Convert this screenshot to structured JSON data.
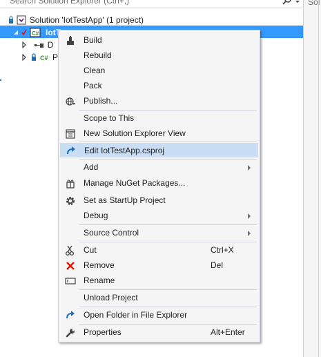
{
  "search": {
    "text": "Search Solution Explorer (Ctrl+;)"
  },
  "side": {
    "tab_label": "Sol"
  },
  "tree": {
    "solution_label": "Solution 'IotTestApp' (1 project)",
    "project_label": "IotTe",
    "dependencies_label": "D",
    "properties_label": "P"
  },
  "menu": {
    "build": "Build",
    "rebuild": "Rebuild",
    "clean": "Clean",
    "pack": "Pack",
    "publish": "Publish...",
    "scope": "Scope to This",
    "new_view": "New Solution Explorer View",
    "edit_csproj": "Edit IotTestApp.csproj",
    "add": "Add",
    "nuget": "Manage NuGet Packages...",
    "startup": "Set as StartUp Project",
    "debug": "Debug",
    "source_control": "Source Control",
    "cut": "Cut",
    "cut_shortcut": "Ctrl+X",
    "remove": "Remove",
    "remove_shortcut": "Del",
    "rename": "Rename",
    "unload": "Unload Project",
    "open_folder": "Open Folder in File Explorer",
    "properties": "Properties",
    "properties_shortcut": "Alt+Enter"
  },
  "colors": {
    "selection": "#3399ff",
    "highlight": "#c9def5",
    "remove_icon": "#e51400",
    "csharp_icon": "#388a34"
  }
}
